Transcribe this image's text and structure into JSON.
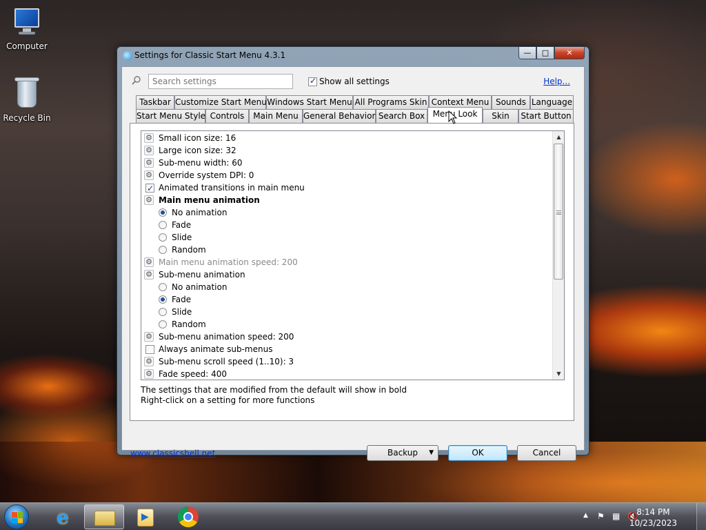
{
  "desktop": {
    "icons": [
      {
        "label": "Computer",
        "icon": "computer-icon"
      },
      {
        "label": "Recycle Bin",
        "icon": "recycle-bin-icon"
      }
    ]
  },
  "window": {
    "title": "Settings for Classic Start Menu 4.3.1",
    "controls": {
      "minimize": "—",
      "maximize": "□",
      "close": "✕"
    }
  },
  "toolbar": {
    "search_placeholder": "Search settings",
    "show_all_label": "Show all settings",
    "show_all_checked": true,
    "help_label": "Help..."
  },
  "tabs": {
    "row1": [
      "Taskbar",
      "Customize Start Menu",
      "Windows Start Menu",
      "All Programs Skin",
      "Context Menu",
      "Sounds",
      "Language"
    ],
    "row2": [
      "Start Menu Style",
      "Controls",
      "Main Menu",
      "General Behavior",
      "Search Box",
      "Menu Look",
      "Skin",
      "Start Button"
    ],
    "active": "Menu Look"
  },
  "settings": [
    {
      "type": "setting",
      "label": "Small icon size: 16"
    },
    {
      "type": "setting",
      "label": "Large icon size: 32"
    },
    {
      "type": "setting",
      "label": "Sub-menu width: 60"
    },
    {
      "type": "setting",
      "label": "Override system DPI: 0"
    },
    {
      "type": "checkbox",
      "label": "Animated transitions in main menu",
      "checked": true
    },
    {
      "type": "setting",
      "label": "Main menu animation",
      "bold": true
    },
    {
      "type": "radio",
      "label": "No animation",
      "selected": true
    },
    {
      "type": "radio",
      "label": "Fade",
      "selected": false
    },
    {
      "type": "radio",
      "label": "Slide",
      "selected": false
    },
    {
      "type": "radio",
      "label": "Random",
      "selected": false
    },
    {
      "type": "setting",
      "label": "Main menu animation speed: 200",
      "disabled": true
    },
    {
      "type": "setting",
      "label": "Sub-menu animation"
    },
    {
      "type": "radio",
      "label": "No animation",
      "selected": false
    },
    {
      "type": "radio",
      "label": "Fade",
      "selected": true
    },
    {
      "type": "radio",
      "label": "Slide",
      "selected": false
    },
    {
      "type": "radio",
      "label": "Random",
      "selected": false
    },
    {
      "type": "setting",
      "label": "Sub-menu animation speed: 200"
    },
    {
      "type": "checkbox",
      "label": "Always animate sub-menus",
      "checked": false
    },
    {
      "type": "setting",
      "label": "Sub-menu scroll speed (1..10): 3"
    },
    {
      "type": "setting",
      "label": "Fade speed: 400"
    }
  ],
  "info": {
    "line1": "The settings that are modified from the default will show in bold",
    "line2": "Right-click on a setting for more functions"
  },
  "footer": {
    "link": "www.classicshell.net",
    "backup_label": "Backup",
    "ok_label": "OK",
    "cancel_label": "Cancel"
  },
  "taskbar": {
    "apps": [
      "internet-explorer-icon",
      "windows-explorer-icon",
      "media-center-icon",
      "chrome-icon"
    ],
    "time": "8:14 PM",
    "date": "10/23/2023"
  }
}
